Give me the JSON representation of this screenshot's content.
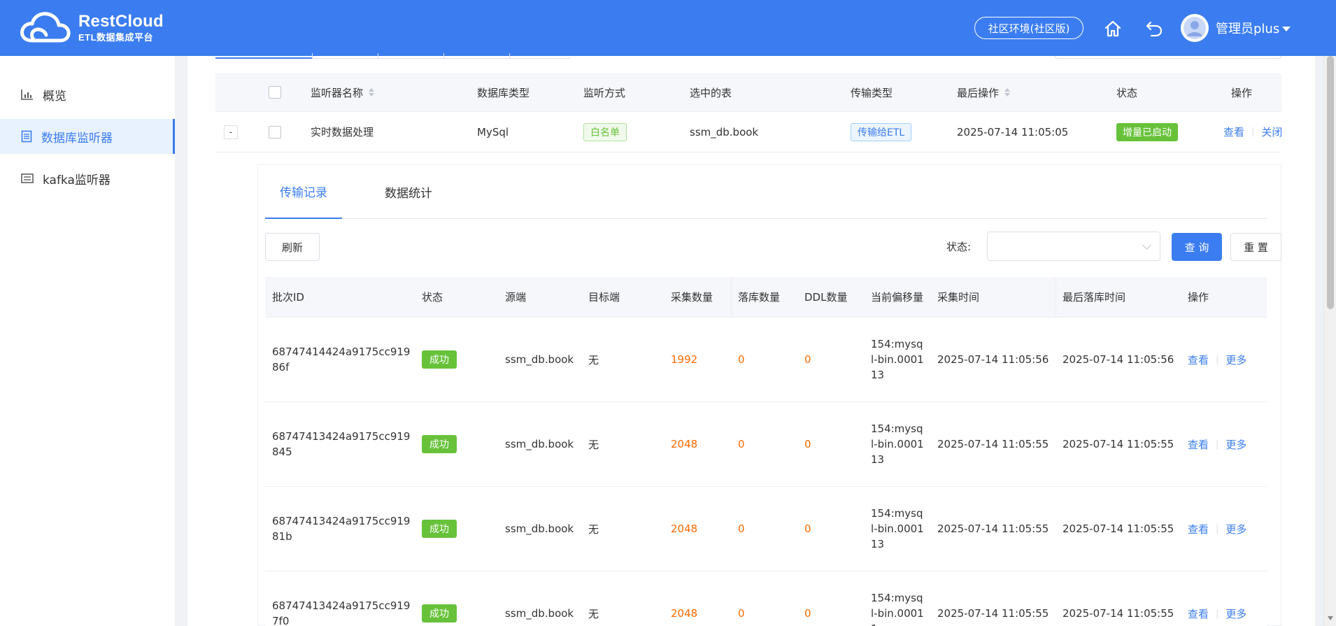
{
  "header": {
    "logo_title": "RestCloud",
    "logo_subtitle": "ETL数据集成平台",
    "env_button": "社区环境(社区版)",
    "user_name": "管理员plus",
    "accent_color": "#3b7df0"
  },
  "sidebar": {
    "items": [
      {
        "label": "概览",
        "icon": "bar-chart-icon"
      },
      {
        "label": "数据库监听器",
        "icon": "database-list-icon",
        "active": true
      },
      {
        "label": "kafka监听器",
        "icon": "kafka-stack-icon"
      }
    ]
  },
  "listener_table": {
    "headers": {
      "name": "监听器名称",
      "db_type": "数据库类型",
      "listen_mode": "监听方式",
      "selected_tables": "选中的表",
      "transfer_type": "传输类型",
      "last_op": "最后操作",
      "status": "状态",
      "action": "操作"
    },
    "row": {
      "expand": "-",
      "name": "实时数据处理",
      "db_type": "MySql",
      "listen_mode": "白名单",
      "selected_tables": "ssm_db.book",
      "transfer_type": "传输给ETL",
      "last_op": "2025-07-14 11:05:05",
      "status": "增量已启动",
      "action_view": "查看",
      "action_close": "关闭"
    }
  },
  "detail": {
    "tabs": [
      "传输记录",
      "数据统计"
    ],
    "refresh_button": "刷新",
    "status_label": "状态:",
    "status_select_value": "",
    "query_button": "查 询",
    "reset_button": "重 置",
    "columns": [
      "批次ID",
      "状态",
      "源端",
      "目标端",
      "采集数量",
      "落库数量",
      "DDL数量",
      "当前偏移量",
      "采集时间",
      "最后落库时间",
      "操作"
    ],
    "rows": [
      {
        "batch_id": "68747414424a9175cc91986f",
        "status": "成功",
        "source": "ssm_db.book",
        "target": "无",
        "collected": "1992",
        "stored": "0",
        "ddl": "0",
        "offset": "154:mysql-bin.000113",
        "collect_time": "2025-07-14 11:05:56",
        "store_time": "2025-07-14 11:05:56",
        "view": "查看",
        "more": "更多"
      },
      {
        "batch_id": "68747413424a9175cc919845",
        "status": "成功",
        "source": "ssm_db.book",
        "target": "无",
        "collected": "2048",
        "stored": "0",
        "ddl": "0",
        "offset": "154:mysql-bin.000113",
        "collect_time": "2025-07-14 11:05:55",
        "store_time": "2025-07-14 11:05:55",
        "view": "查看",
        "more": "更多"
      },
      {
        "batch_id": "68747413424a9175cc91981b",
        "status": "成功",
        "source": "ssm_db.book",
        "target": "无",
        "collected": "2048",
        "stored": "0",
        "ddl": "0",
        "offset": "154:mysql-bin.000113",
        "collect_time": "2025-07-14 11:05:55",
        "store_time": "2025-07-14 11:05:55",
        "view": "查看",
        "more": "更多"
      },
      {
        "batch_id": "68747413424a9175cc9197f0",
        "status": "成功",
        "source": "ssm_db.book",
        "target": "无",
        "collected": "2048",
        "stored": "0",
        "ddl": "0",
        "offset": "154:mysql-bin.00011",
        "collect_time": "2025-07-14 11:05:55",
        "store_time": "2025-07-14 11:05:55",
        "view": "查看",
        "more": "更多"
      }
    ]
  }
}
